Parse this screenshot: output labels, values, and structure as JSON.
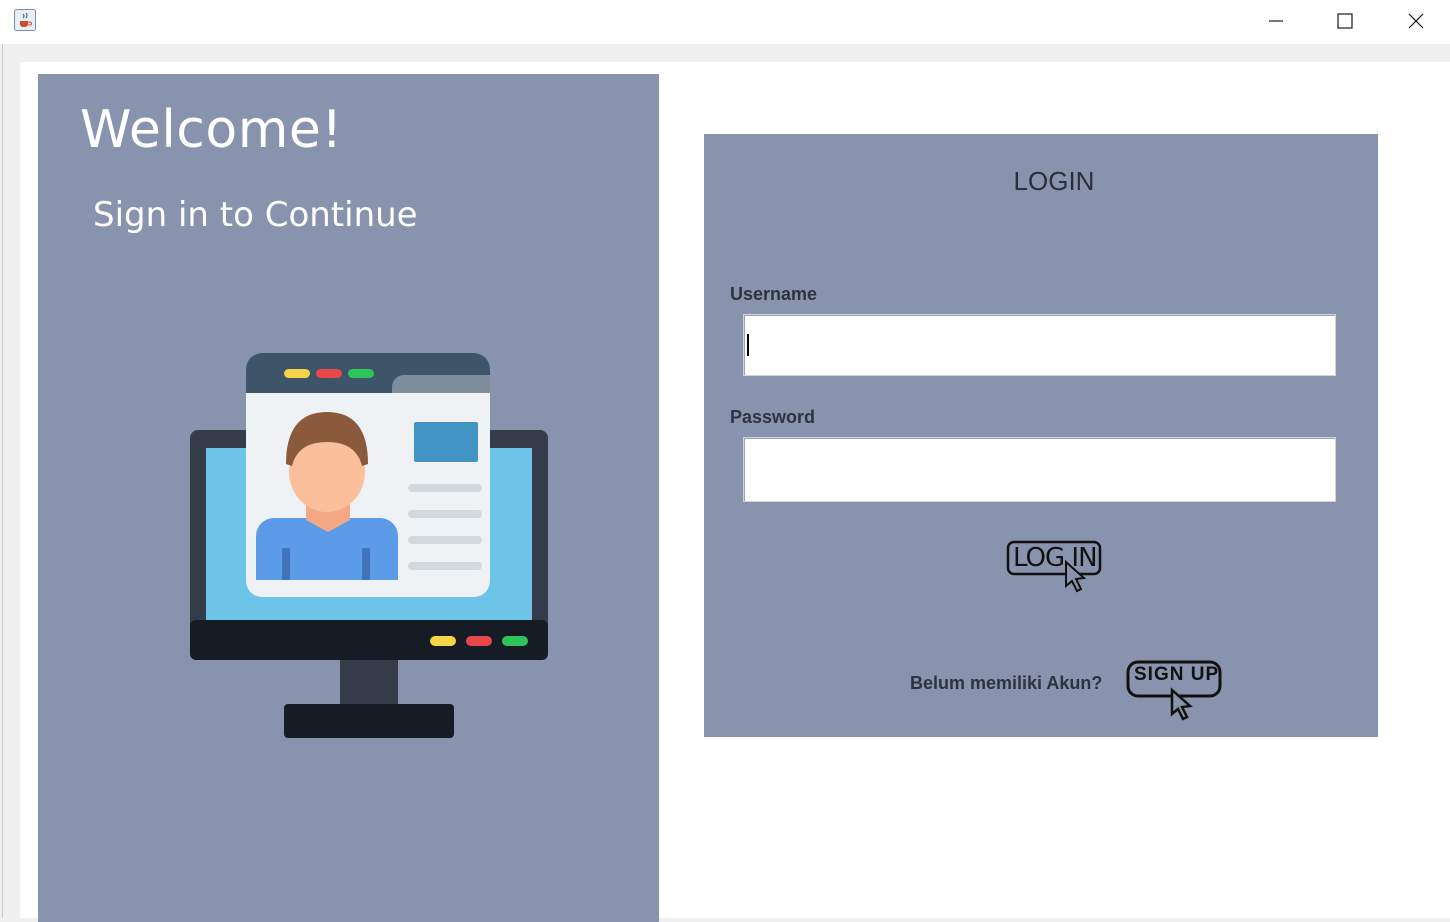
{
  "window": {
    "app_icon": "java-cup-icon",
    "controls": {
      "minimize": "minimize-icon",
      "maximize": "maximize-icon",
      "close": "close-icon"
    }
  },
  "left_panel": {
    "heading": "Welcome!",
    "subheading": "Sign in to Continue",
    "illustration": "computer-user-profile-icon"
  },
  "login_form": {
    "title": "LOGIN",
    "username_label": "Username",
    "username_value": "",
    "password_label": "Password",
    "password_value": "",
    "login_button_label": "LOG IN",
    "signup_prompt": "Belum memiliki Akun?",
    "signup_button_label": "SIGN UP"
  },
  "colors": {
    "panel": "#8894ad",
    "window_frame": "#f0f0f0",
    "text_dark": "#2e3340",
    "screen_blue": "#6cc4e8",
    "shirt_blue": "#5b9be8"
  }
}
